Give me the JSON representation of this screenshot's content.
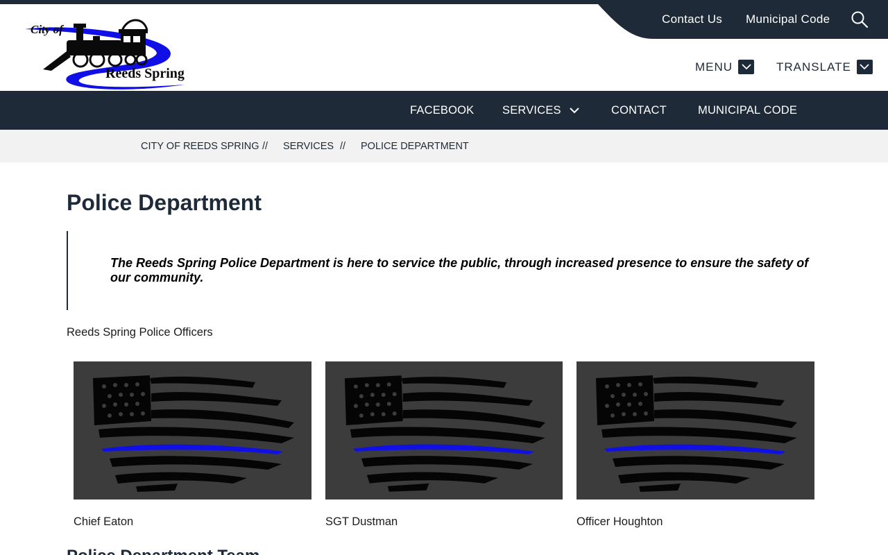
{
  "site": {
    "logo_text_top": "City of",
    "logo_text_bottom": "Reeds Spring"
  },
  "utility": {
    "contact_label": "Contact Us",
    "code_label": "Municipal Code",
    "search_icon": "search-icon"
  },
  "header_buttons": {
    "menu_label": "MENU",
    "translate_label": "TRANSLATE"
  },
  "nav": {
    "items": [
      {
        "label": "FACEBOOK"
      },
      {
        "label": "SERVICES"
      },
      {
        "label": "CONTACT"
      },
      {
        "label": "MUNICIPAL CODE"
      }
    ]
  },
  "breadcrumb": {
    "items": [
      "CITY OF REEDS SPRING",
      "SERVICES",
      "POLICE DEPARTMENT"
    ],
    "separator": "//"
  },
  "page": {
    "title": "Police Department",
    "quote": "The Reeds Spring Police Department is here to service the public, through increased presence to ensure the safety of our community.",
    "officers_label": "Reeds Spring Police Officers",
    "next_heading": "Police Department Team"
  },
  "officers": [
    {
      "name": "Chief Eaton"
    },
    {
      "name": "SGT Dustman"
    },
    {
      "name": "Officer Houghton"
    }
  ],
  "colors": {
    "navy": "#1e2a38",
    "thin_blue_line": "#1010e6",
    "photo_bg": "#3c3c3c"
  }
}
